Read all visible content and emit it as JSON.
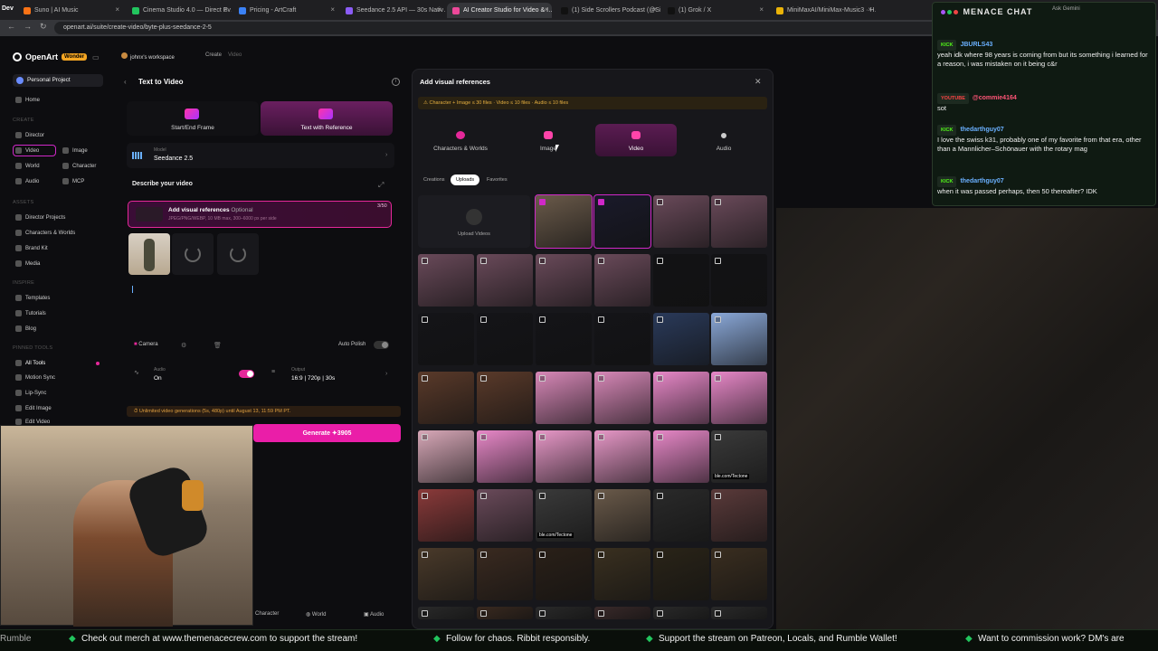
{
  "browser": {
    "tabs": [
      {
        "label": "Suno | AI Music",
        "color": "#f97316"
      },
      {
        "label": "Cinema Studio 4.0 — Direct Ev…",
        "color": "#22c55e"
      },
      {
        "label": "Pricing - ArtCraft",
        "color": "#3b82f6"
      },
      {
        "label": "Seedance 2.5 API — 30s Nativ…",
        "color": "#8b5cf6"
      },
      {
        "label": "AI Creator Studio for Video & I…",
        "color": "#ec4899"
      },
      {
        "label": "(1) Side Scrollers Podcast (@Si…",
        "color": "#111111"
      },
      {
        "label": "(1) Grok / X",
        "color": "#111111"
      },
      {
        "label": "MiniMaxAI/MiniMax-Music3 · H…",
        "color": "#eab308"
      }
    ],
    "url": "openart.ai/suite/create-video/byte-plus-seedance-2-5",
    "left_fragment": "Dev"
  },
  "sidebar": {
    "brand": "OpenArt",
    "badge": "Wonder",
    "project": "Personal Project",
    "home": "Home",
    "create_hdr": "CREATE",
    "director": "Director",
    "video": "Video",
    "image": "Image",
    "world": "World",
    "character": "Character",
    "audio": "Audio",
    "mcp": "MCP",
    "assets_hdr": "ASSETS",
    "director_projects": "Director Projects",
    "characters_worlds": "Characters & Worlds",
    "brand_kit": "Brand Kit",
    "media": "Media",
    "inspire_hdr": "INSPIRE",
    "templates": "Templates",
    "tutorials": "Tutorials",
    "blog": "Blog",
    "pinned_hdr": "PINNED TOOLS",
    "all_tools": "All Tools",
    "motion_sync": "Motion Sync",
    "lip_sync": "Lip-Sync",
    "edit_image": "Edit Image",
    "edit_video": "Edit Video"
  },
  "main": {
    "workspace": "johnx's workspace",
    "crumb_create": "Create",
    "crumb_video": "Video",
    "title": "Text to Video",
    "tab_startend": "Start/End Frame",
    "tab_reference": "Text with Reference",
    "model_label": "Model",
    "model_value": "Seedance 2.5",
    "describe": "Describe your video",
    "addref_title": "Add visual references",
    "addref_optional": "Optional",
    "addref_sub": "JPEG/PNG/WEBP, 10 MB max, 300–6000 px per side",
    "addref_count": "3/50",
    "camera": "Camera",
    "auto_polish": "Auto Polish",
    "audio_label": "Audio",
    "audio_value": "On",
    "output_label": "Output",
    "output_value": "16:9 | 720p | 30s",
    "unlimited": "Unlimited video generations (5s, 480p) until August 13, 11:59 PM PT.",
    "generate": "Generate",
    "generate_cost": "3905",
    "bottom_character": "Character",
    "bottom_world": "World",
    "bottom_audio": "Audio"
  },
  "modal": {
    "title": "Add visual references",
    "warning": "Character + Image ≤ 30 files · Video ≤ 10 files · Audio ≤ 10 files",
    "cat_characters": "Characters & Worlds",
    "cat_image": "Image",
    "cat_video": "Video",
    "cat_audio": "Audio",
    "sub_creations": "Creations",
    "sub_uploads": "Uploads",
    "sub_favorites": "Favorites",
    "upload_videos": "Upload Videos",
    "grid_caption": "ble.com/Tectone"
  },
  "chat": {
    "title": "MENACE CHAT",
    "ask": "Ask Gemini",
    "messages": [
      {
        "platform": "KICK",
        "user": "JBURLS43",
        "user_color": "#6ab0ff",
        "text": "yeah idk where 98 years is coming from but its something i learned for a reason, i was mistaken on it being c&r"
      },
      {
        "platform": "YOUTUBE",
        "user": "@commie4164",
        "user_color": "#ff5577",
        "text": "sot"
      },
      {
        "platform": "KICK",
        "user": "thedarthguy07",
        "user_color": "#6ab0ff",
        "text": "I love the swiss k31, probably one of my favorite from that era, other than a Mannlicher–Schönauer with the rotary mag"
      },
      {
        "platform": "KICK",
        "user": "thedarthguy07",
        "user_color": "#6ab0ff",
        "text": "when it was passed perhaps, then 50 thereafter? IDK"
      }
    ]
  },
  "ticker": [
    "Rumble",
    "Check out merch at www.themenacecrew.com to support the stream!",
    "Follow for chaos. Ribbit responsibly.",
    "Support the stream on Patreon, Locals, and Rumble Wallet!",
    "Want to commission work? DM's are"
  ]
}
